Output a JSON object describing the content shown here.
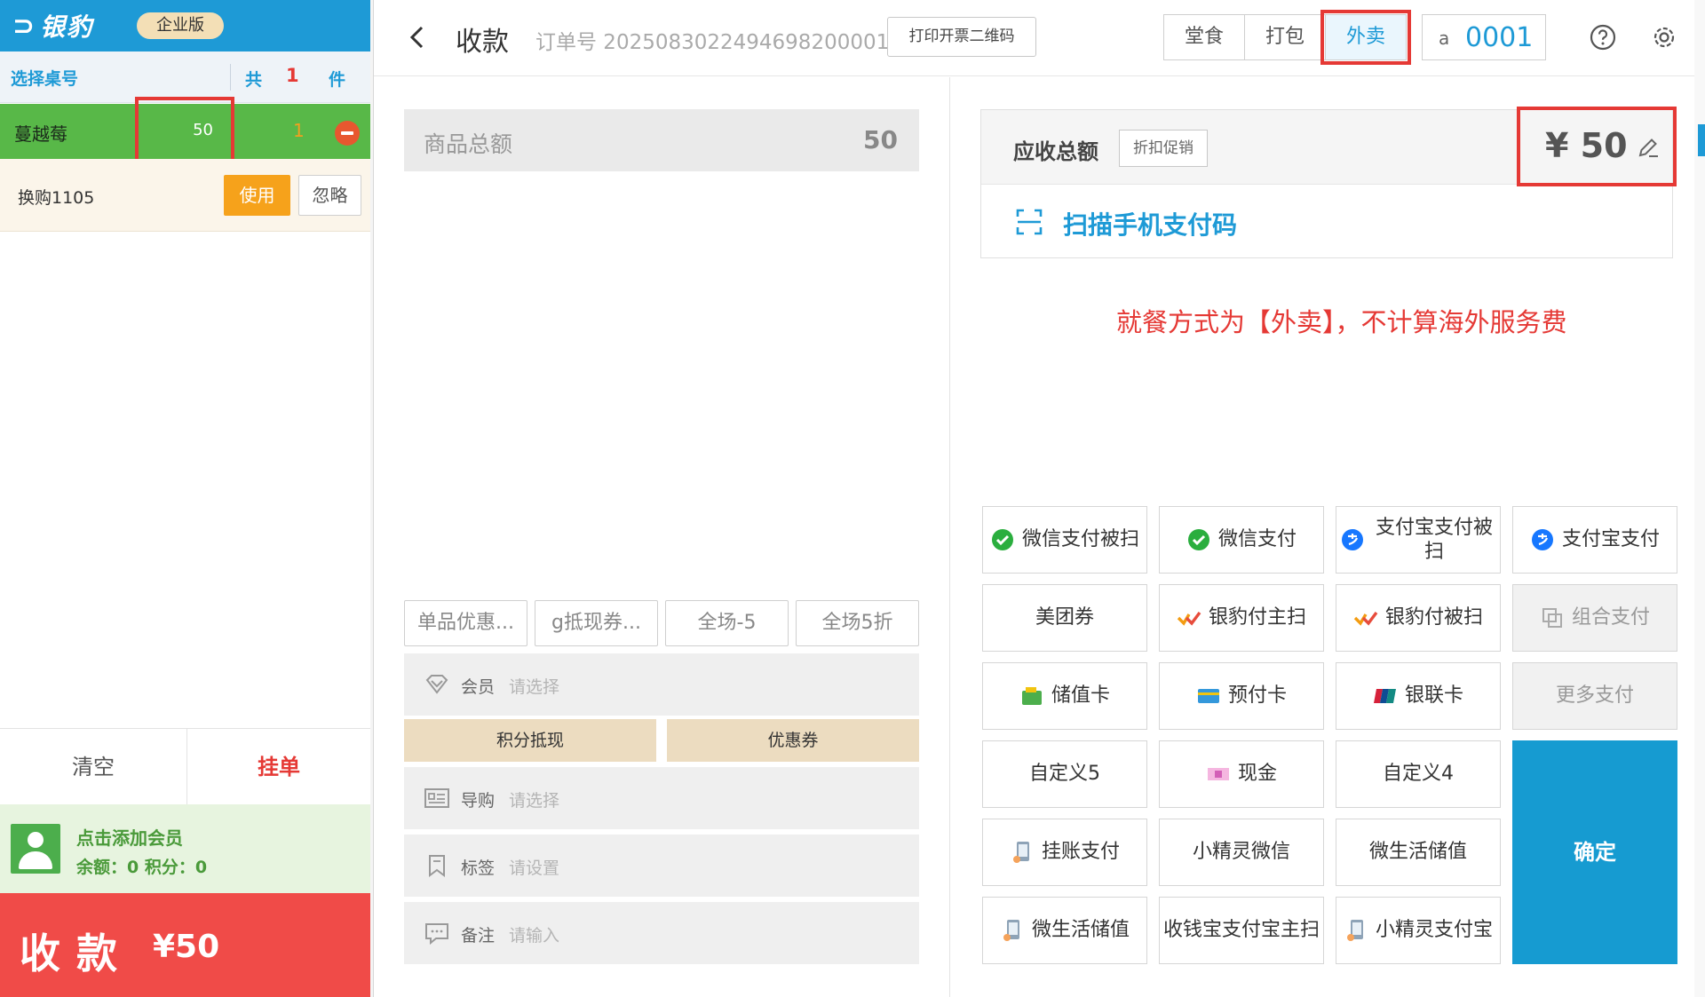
{
  "left_panel": {
    "brand": "银豹",
    "edition": "企业版",
    "select_table": "选择桌号",
    "total_label": "共",
    "total_count": "1",
    "piece_label": "件",
    "item": {
      "name": "蔓越莓",
      "price": "50",
      "qty": "1"
    },
    "promo": {
      "name": "换购1105",
      "use": "使用",
      "ignore": "忽略"
    },
    "clear": "清空",
    "hold": "挂单",
    "member": {
      "add": "点击添加会员",
      "balance": "余额：0  积分：0"
    },
    "checkout": {
      "label": "收款",
      "amount": "¥50"
    }
  },
  "dialog": {
    "title": "收款",
    "order_no": "订单号 2025083022494698200001",
    "print_qr": "打印开票二维码",
    "dine_tabs": [
      "堂食",
      "打包",
      "外卖"
    ],
    "active_dine": "外卖",
    "table_prefix": "a",
    "table_no": "0001",
    "goods_total_label": "商品总额",
    "goods_total_value": "50",
    "promo_tabs": [
      "单品优惠...",
      "g抵现券...",
      "全场-5",
      "全场5折"
    ],
    "member_row": {
      "label": "会员",
      "placeholder": "请选择"
    },
    "points_btn": "积分抵现",
    "coupon_btn": "优惠券",
    "guide_row": {
      "label": "导购",
      "placeholder": "请选择"
    },
    "tag_row": {
      "label": "标签",
      "placeholder": "请设置"
    },
    "note_row": {
      "label": "备注",
      "placeholder": "请输入"
    },
    "receivable_label": "应收总额",
    "discount_btn": "折扣促销",
    "amount": "¥ 50",
    "scan_label": "扫描手机支付码",
    "notice": "就餐方式为【外卖】，不计算海外服务费",
    "pay_methods": [
      [
        "微信支付被扫",
        "微信支付",
        "支付宝支付被扫",
        "支付宝支付"
      ],
      [
        "美团券",
        "银豹付主扫",
        "银豹付被扫",
        "组合支付"
      ],
      [
        "储值卡",
        "预付卡",
        "银联卡",
        "更多支付"
      ],
      [
        "自定义5",
        "现金",
        "自定义4"
      ],
      [
        "挂账支付",
        "小精灵微信",
        "微生活储值"
      ],
      [
        "微生活储值",
        "收钱宝支付宝主扫",
        "小精灵支付宝"
      ]
    ],
    "confirm": "确定"
  },
  "colors": {
    "brand_blue": "#1e9ad6",
    "accent_red": "#e53935",
    "item_green": "#58b848",
    "checkout_red": "#f04b48",
    "use_orange": "#f6a21b",
    "confirm_blue": "#169bd1"
  },
  "icons": [
    "back-icon",
    "help-icon",
    "gear-icon",
    "edit-icon",
    "scan-icon",
    "diamond-icon",
    "id-card-icon",
    "bookmark-icon",
    "chat-icon",
    "wechat-icon",
    "alipay-icon",
    "yinbao-icon",
    "wallet-icon",
    "card-icon",
    "unionpay-icon",
    "cash-icon",
    "phone-icon",
    "combine-icon",
    "remove-icon",
    "avatar-icon"
  ]
}
